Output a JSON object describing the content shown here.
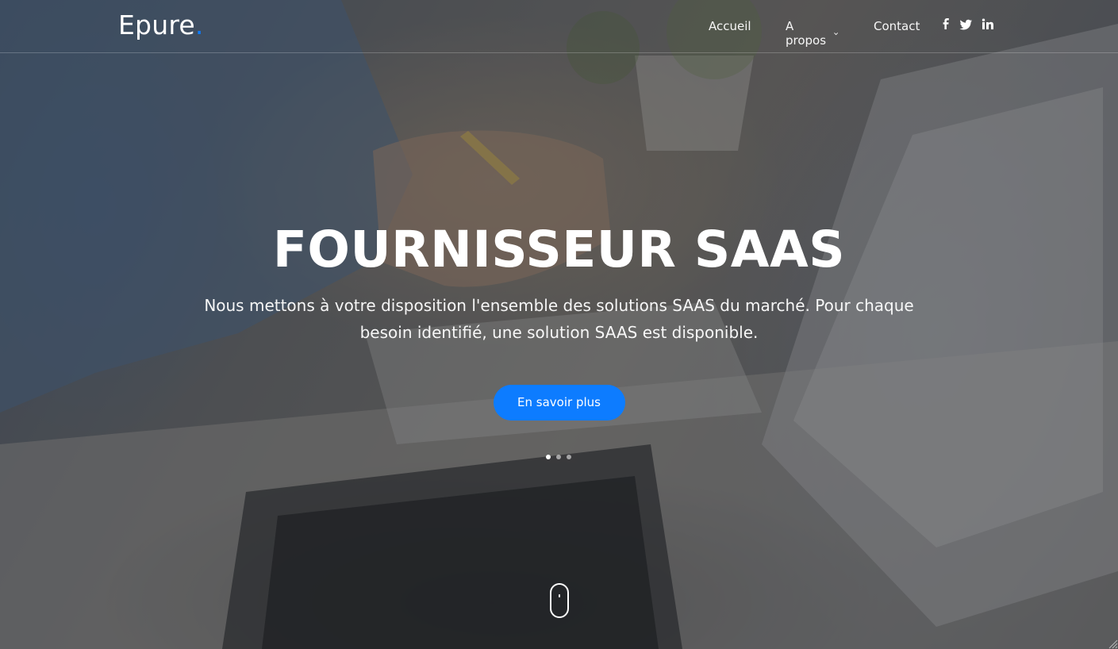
{
  "header": {
    "logo_text": "Epure",
    "logo_dot": ".",
    "nav": [
      {
        "label": "Accueil"
      },
      {
        "label": "A propos"
      },
      {
        "label": "Contact"
      }
    ],
    "social_icons": [
      "facebook-icon",
      "twitter-icon",
      "linkedin-icon"
    ]
  },
  "hero": {
    "title": "FOURNISSEUR SAAS",
    "text": "Nous mettons à votre disposition l'ensemble des solutions SAAS du marché. Pour chaque besoin identifié, une solution SAAS est disponible.",
    "cta_label": "En savoir plus",
    "slider": {
      "active": 1,
      "count": 3
    }
  },
  "colors": {
    "accent": "#0d7cff",
    "text": "#ffffff"
  }
}
